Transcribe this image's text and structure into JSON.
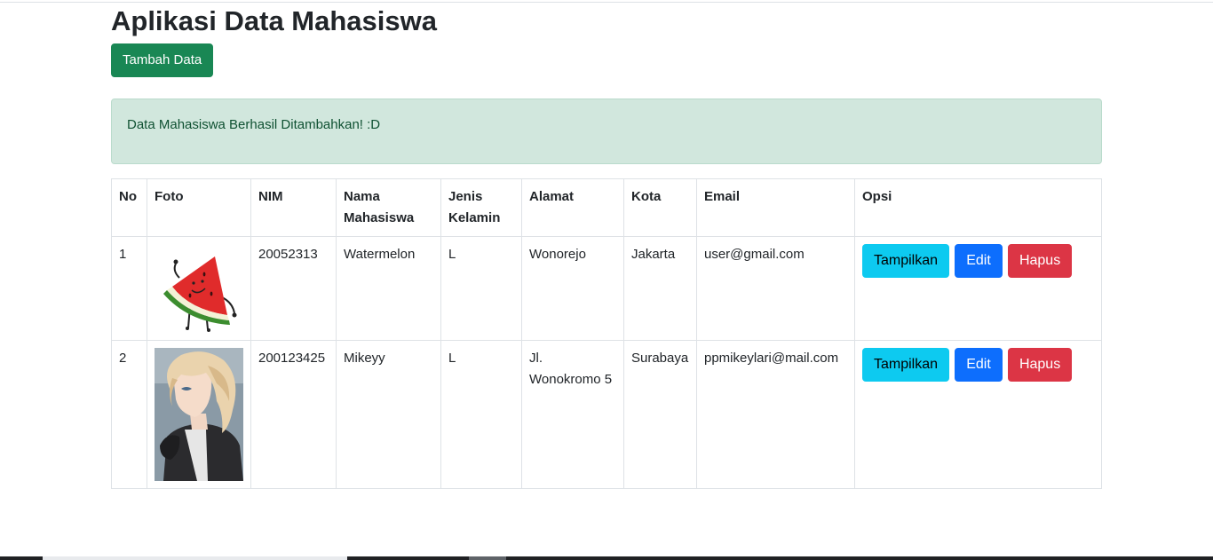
{
  "page": {
    "title": "Aplikasi Data Mahasiswa",
    "add_button": "Tambah Data",
    "alert": "Data Mahasiswa Berhasil Ditambahkan! :D"
  },
  "table": {
    "headers": [
      "No",
      "Foto",
      "NIM",
      "Nama Mahasiswa",
      "Jenis Kelamin",
      "Alamat",
      "Kota",
      "Email",
      "Opsi"
    ],
    "rows": [
      {
        "no": "1",
        "photo": "watermelon-slice-character",
        "nim": "20052313",
        "nama": "Watermelon",
        "jk": "L",
        "alamat": "Wonorejo",
        "kota": "Jakarta",
        "email": "user@gmail.com"
      },
      {
        "no": "2",
        "photo": "anime-boy-portrait",
        "nim": "200123425",
        "nama": "Mikeyy",
        "jk": "L",
        "alamat": "Jl. Wonokromo 5",
        "kota": "Surabaya",
        "email": "ppmikeylari@mail.com"
      }
    ],
    "actions": {
      "show": "Tampilkan",
      "edit": "Edit",
      "delete": "Hapus"
    }
  },
  "colors": {
    "success": "#198754",
    "info": "#0dcaf0",
    "primary": "#0d6efd",
    "danger": "#dc3545",
    "alert_bg": "#d1e7dd",
    "alert_text": "#0f5132"
  }
}
